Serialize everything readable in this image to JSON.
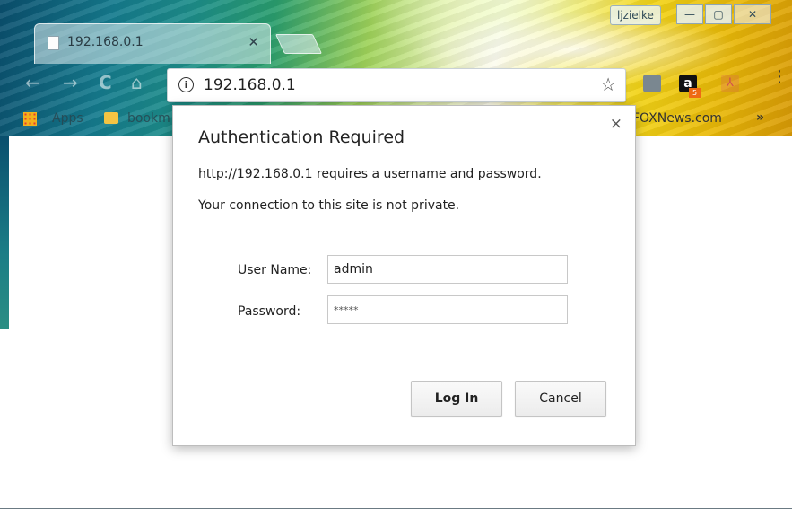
{
  "window": {
    "user_label": "ljzielke",
    "minimize_symbol": "—",
    "maximize_symbol": "▢",
    "close_symbol": "✕"
  },
  "tab": {
    "title": "192.168.0.1",
    "close_symbol": "✕",
    "icon": "page-icon"
  },
  "toolbar": {
    "back_symbol": "←",
    "forward_symbol": "→",
    "reload_symbol": "C",
    "home_symbol": "⌂",
    "url": "192.168.0.1",
    "info_symbol": "i",
    "star_symbol": "☆",
    "extensions": [
      "gray-extension-icon",
      "amazon-extension-icon",
      "pdf-extension-icon"
    ],
    "amazon_letter": "a",
    "amazon_badge": "5",
    "menu_symbol": "⋮"
  },
  "bookmarks": {
    "apps_label": "Apps",
    "folder_label": "bookm",
    "right_label": "FOXNews.com",
    "more_symbol": "»"
  },
  "dialog": {
    "title": "Authentication Required",
    "message_line1": "http://192.168.0.1 requires a username and password.",
    "message_line2": "Your connection to this site is not private.",
    "username_label": "User Name:",
    "username_value": "admin",
    "password_label": "Password:",
    "password_value": "*****",
    "login_label": "Log In",
    "cancel_label": "Cancel",
    "close_symbol": "×"
  }
}
